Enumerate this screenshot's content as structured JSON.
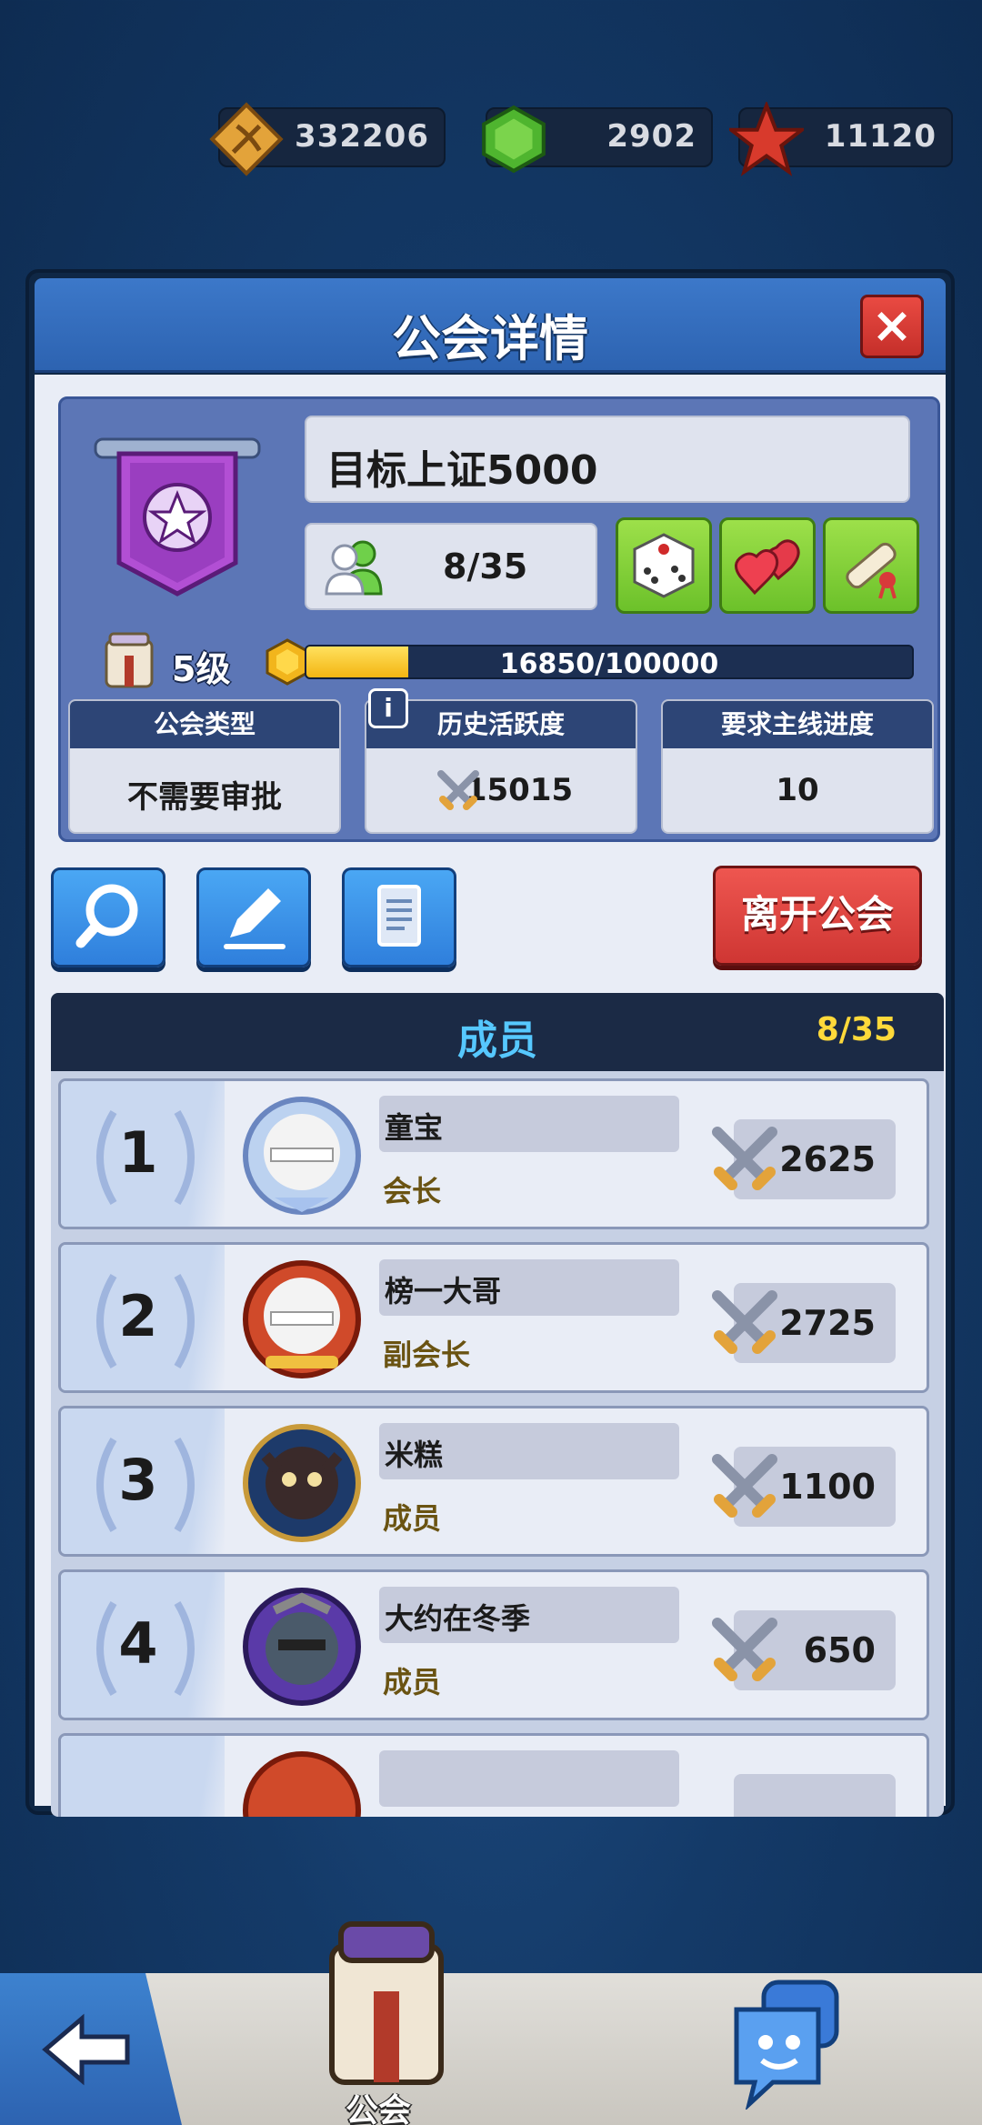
{
  "currencies": [
    {
      "icon": "bow-ticket-icon",
      "value": "332206"
    },
    {
      "icon": "green-gem-icon",
      "value": "2902"
    },
    {
      "icon": "red-star-icon",
      "value": "11120"
    }
  ],
  "panel": {
    "title": "公会详情",
    "close_label": "×"
  },
  "guild": {
    "name": "目标上证5000",
    "member_count": "8/35",
    "level": "5级",
    "xp_text": "16850/100000",
    "xp_fraction": 0.1685,
    "stats": [
      {
        "label": "公会类型",
        "value": "不需要审批"
      },
      {
        "label": "历史活跃度",
        "value": "15015"
      },
      {
        "label": "要求主线进度",
        "value": "10"
      }
    ]
  },
  "actions": {
    "leave_label": "离开公会"
  },
  "members_section": {
    "title": "成员",
    "count": "8/35",
    "rows": [
      {
        "rank": "1",
        "name": "童宝",
        "role": "会长",
        "power": "2625"
      },
      {
        "rank": "2",
        "name": "榜一大哥",
        "role": "副会长",
        "power": "2725"
      },
      {
        "rank": "3",
        "name": "米糕",
        "role": "成员",
        "power": "1100"
      },
      {
        "rank": "4",
        "name": "大约在冬季",
        "role": "成员",
        "power": "650"
      }
    ]
  },
  "bottom_nav": {
    "guild_tab_label": "公会"
  },
  "colors": {
    "header_blue": "#3c78c9",
    "green_button": "#7dcd32",
    "red_button": "#e0443e",
    "member_title": "#56c8ff",
    "count_yellow": "#ffd93a"
  }
}
